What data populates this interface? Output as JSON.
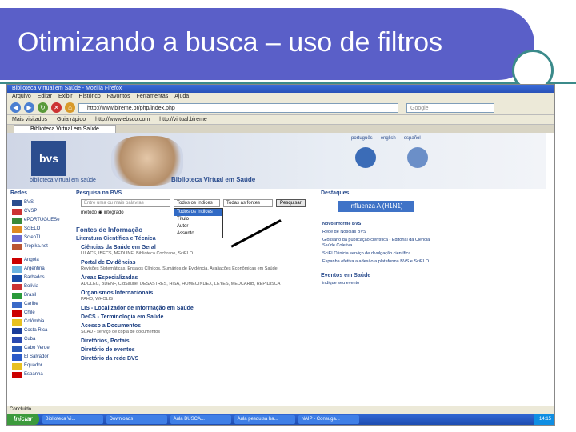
{
  "slide": {
    "title": "Otimizando a busca – uso de filtros"
  },
  "browser": {
    "window_title": "Biblioteca Virtual em Saúde - Mozilla Firefox",
    "menu": [
      "Arquivo",
      "Editar",
      "Exibir",
      "Histórico",
      "Favoritos",
      "Ferramentas",
      "Ajuda"
    ],
    "url": "http://www.bireme.br/php/index.php",
    "search_placeholder": "Google",
    "bookmarks": [
      "Mais visitados",
      "Guia rápido",
      "http://www.ebsco.com",
      "http://virtual.bireme"
    ],
    "tab_label": "Biblioteca Virtual em Saúde",
    "status": "Concluído"
  },
  "site": {
    "logo": "bvs",
    "logo_sub": "biblioteca virtual em saúde",
    "banner_title": "Biblioteca Virtual em Saúde",
    "top_links": [
      "português",
      "english",
      "español"
    ],
    "left": {
      "redes_heading": "Redes",
      "redes": [
        "BVS",
        "CVSP",
        "ePORTUGUESe",
        "SciELO",
        "ScienTI",
        "Tropika.net"
      ],
      "paises": [
        "Angola",
        "Argentina",
        "Barbados",
        "Bolívia",
        "Brasil",
        "Caribe",
        "Chile",
        "Colômbia",
        "Costa Rica",
        "Cuba",
        "Cabo Verde",
        "El Salvador",
        "Equador",
        "Espanha"
      ]
    },
    "middle": {
      "pesquisa_heading": "Pesquisa na BVS",
      "input_placeholder": "Entre uma ou mais palavras",
      "select_index": "Todos os índices",
      "select_source": "Todas as fontes",
      "search_button": "Pesquisar",
      "metodo_label": "método",
      "metodo_option": "integrado",
      "dropdown": [
        "Todos os índices",
        "Título",
        "Autor",
        "Assunto"
      ],
      "fontes_heading": "Fontes de Informação",
      "lit_heading": "Literatura Científica e Técnica",
      "items": [
        {
          "title": "Ciências da Saúde em Geral",
          "sub": "LILACS, IBECS, MEDLINE, Biblioteca Cochrane, SciELO"
        },
        {
          "title": "Portal de Evidências",
          "sub": "Revisões Sistemáticas, Ensaios Clínicos, Sumários de Evidência, Avaliações Econômicas em Saúde"
        },
        {
          "title": "Áreas Especializadas",
          "sub": "ADOLEC, BDENF, CidSaúde, DESASTRES, HISA, HOMEOINDEX, LEYES, MEDCARIB, REPIDISCA"
        },
        {
          "title": "Organismos Internacionais",
          "sub": "PAHO, WHOLIS"
        },
        {
          "title": "LIS - Localizador de Informação em Saúde",
          "sub": ""
        },
        {
          "title": "DeCS - Terminologia em Saúde",
          "sub": ""
        },
        {
          "title": "Acesso a Documentos",
          "sub": "SCAD - serviço de cópia de documentos"
        },
        {
          "title": "Diretórios, Portais",
          "sub": ""
        },
        {
          "title": "Diretório de eventos",
          "sub": ""
        },
        {
          "title": "Diretório da rede BVS",
          "sub": ""
        }
      ]
    },
    "right": {
      "destaques_heading": "Destaques",
      "flu_button": "Influenza A (H1N1)",
      "news": [
        "Novo Informe BVS",
        "Rede de Notícias BVS",
        "Glossário da publicação científica - Editorial da Ciência Saúde Coletiva",
        "SciELO inicia serviço de divulgação científica",
        "Espanha efetiva a adesão a plataforma BVS e SciELO"
      ],
      "eventos_heading": "Eventos em Saúde",
      "eventos_link": "indique seu evento"
    }
  },
  "taskbar": {
    "start": "Iniciar",
    "items": [
      "Biblioteca Vi...",
      "Downloads",
      "Aula BUSCA...",
      "Aula pesquisa ba...",
      "NAIP - Consuga..."
    ],
    "clock": "14:15"
  },
  "colors": {
    "slide_band": "#5a5fc8",
    "accent": "#3b8a8a",
    "link": "#1a3d80"
  }
}
